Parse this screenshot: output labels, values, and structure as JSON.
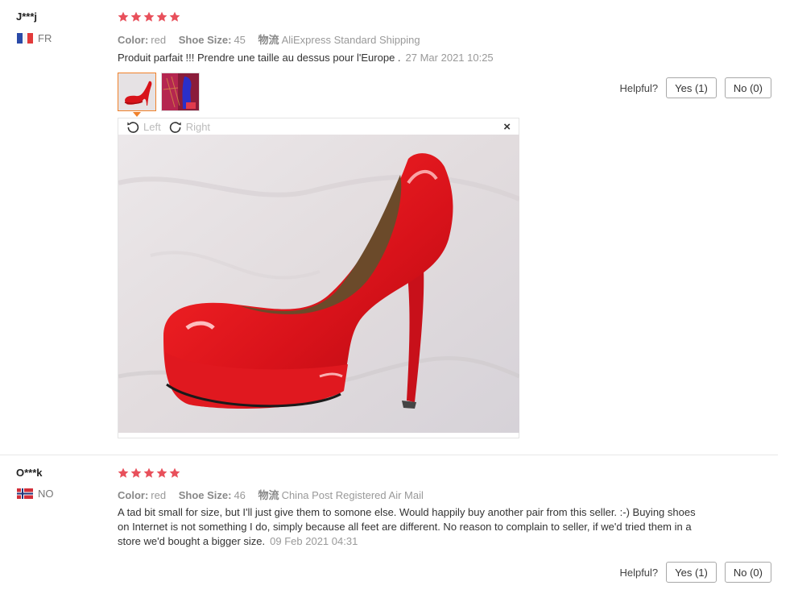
{
  "reviews": [
    {
      "user": "J***j",
      "country": "FR",
      "rating": 5,
      "color_label": "Color:",
      "color": "red",
      "size_label": "Shoe Size:",
      "size": "45",
      "shipping_label": "物流",
      "shipping": "AliExpress Standard Shipping",
      "text": "Produit parfait !!! Prendre une taille au dessus pour l'Europe .",
      "date": "27 Mar 2021 10:25",
      "helpful_label": "Helpful?",
      "yes_label": "Yes (1)",
      "no_label": "No (0)"
    },
    {
      "user": "O***k",
      "country": "NO",
      "rating": 5,
      "color_label": "Color:",
      "color": "red",
      "size_label": "Shoe Size:",
      "size": "46",
      "shipping_label": "物流",
      "shipping": "China Post Registered Air Mail",
      "text": "A tad bit small for size, but I'll just give them to somone else. Would happily buy another pair from this seller. :-) Buying shoes on Internet is not something I do, simply because all feet are different. No reason to complain to seller, if we'd tried them in a store we'd bought a bigger size.",
      "date": "09 Feb 2021 04:31",
      "helpful_label": "Helpful?",
      "yes_label": "Yes (1)",
      "no_label": "No (0)"
    }
  ],
  "viewer": {
    "rotate_left_label": "Left",
    "rotate_right_label": "Right",
    "close_label": "×"
  },
  "colors": {
    "star": "#e8505b",
    "accent_border": "#f0812a"
  }
}
